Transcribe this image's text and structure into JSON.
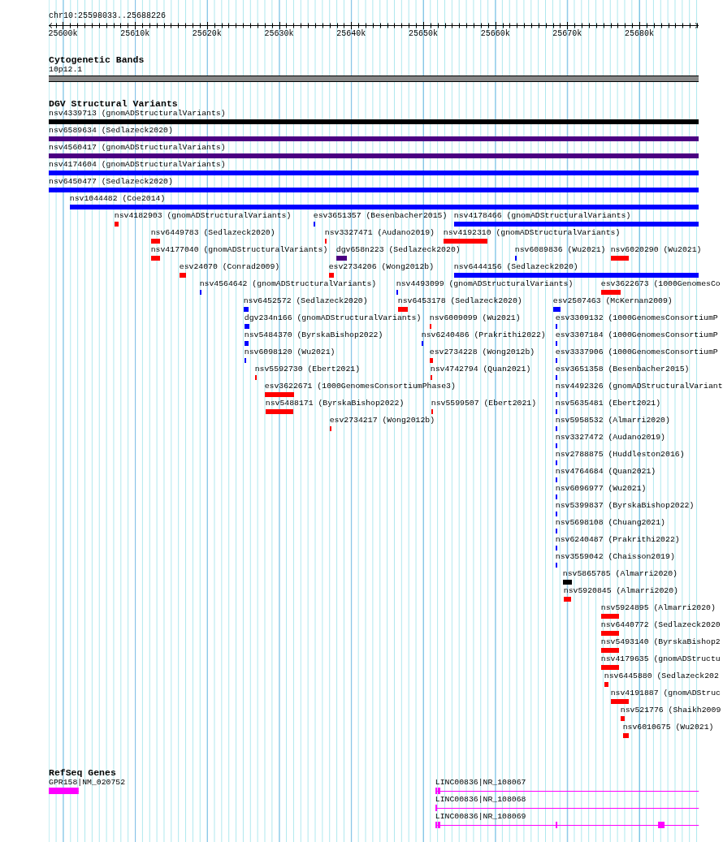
{
  "view": {
    "location": "chr10:25598033..25688226"
  },
  "ticks": [
    "25600k",
    "25610k",
    "25620k",
    "25630k",
    "25640k",
    "25650k",
    "25660k",
    "25670k",
    "25680k"
  ],
  "tracks": [
    {
      "kind": "cytoband",
      "title": "Cytogenetic Bands",
      "bands": [
        {
          "name": "10p12.1",
          "color": "#888888"
        }
      ]
    },
    {
      "kind": "variants",
      "title": "DGV Structural Variants",
      "rows": [
        [
          {
            "label": "nsv4339713 (gnomADStructuralVariants)",
            "color": "#000000"
          }
        ],
        [
          {
            "label": "nsv6589634 (Sedlazeck2020)",
            "color": "#4b0082"
          }
        ],
        [
          {
            "label": "nsv4560417 (gnomADStructuralVariants)",
            "color": "#4b0082"
          }
        ],
        [
          {
            "label": "nsv4174604 (gnomADStructuralVariants)",
            "color": "#0000ff"
          }
        ],
        [
          {
            "label": "nsv6450477 (Sedlazeck2020)",
            "color": "#0000ff"
          }
        ],
        [
          {
            "label": "nsv1044482 (Coe2014)",
            "color": "#0000ff"
          }
        ],
        [
          {
            "label": "nsv4182903 (gnomADStructuralVariants)",
            "color": "#ff0000"
          },
          {
            "label": "esv3651357 (Besenbacher2015)",
            "color": "#0000ff"
          },
          {
            "label": "nsv4178466 (gnomADStructuralVariants)",
            "color": "#0000ff"
          }
        ],
        [
          {
            "label": "nsv6449783 (Sedlazeck2020)",
            "color": "#ff0000"
          },
          {
            "label": "nsv3327471 (Audano2019)",
            "color": "#ff0000"
          },
          {
            "label": "nsv4192310 (gnomADStructuralVariants)",
            "color": "#ff0000"
          }
        ],
        [
          {
            "label": "nsv4177040 (gnomADStructuralVariants)",
            "color": "#ff0000"
          },
          {
            "label": "dgv658n223 (Sedlazeck2020)",
            "color": "#4b0082"
          },
          {
            "label": "nsv6089836 (Wu2021)",
            "color": "#0000ff"
          },
          {
            "label": "nsv6020290 (Wu2021)",
            "color": "#ff0000"
          }
        ],
        [
          {
            "label": "esv24070 (Conrad2009)",
            "color": "#ff0000"
          },
          {
            "label": "esv2734206 (Wong2012b)",
            "color": "#ff0000"
          },
          {
            "label": "nsv6444156 (Sedlazeck2020)",
            "color": "#0000ff"
          }
        ],
        [
          {
            "label": "nsv4564642 (gnomADStructuralVariants)",
            "color": "#0000ff"
          },
          {
            "label": "nsv4493099 (gnomADStructuralVariants)",
            "color": "#0000ff"
          },
          {
            "label": "esv3622673 (1000GenomesCo",
            "color": "#ff0000"
          }
        ],
        [
          {
            "label": "nsv6452572 (Sedlazeck2020)",
            "color": "#0000ff"
          },
          {
            "label": "nsv6453178 (Sedlazeck2020)",
            "color": "#ff0000"
          },
          {
            "label": "esv2507463 (McKernan2009)",
            "color": "#0000ff"
          }
        ],
        [
          {
            "label": "dgv234n166 (gnomADStructuralVariants)",
            "color": "#0000ff"
          },
          {
            "label": "nsv6009099 (Wu2021)",
            "color": "#ff0000"
          },
          {
            "label": "esv3309132 (1000GenomesConsortiumP",
            "color": "#0000ff"
          }
        ],
        [
          {
            "label": "nsv5484370 (ByrskaBishop2022)",
            "color": "#0000ff"
          },
          {
            "label": "nsv6240486 (Prakrithi2022)",
            "color": "#0000ff"
          },
          {
            "label": "esv3307184 (1000GenomesConsortiumP",
            "color": "#0000ff"
          }
        ],
        [
          {
            "label": "nsv6098120 (Wu2021)",
            "color": "#0000ff"
          },
          {
            "label": "esv2734228 (Wong2012b)",
            "color": "#ff0000"
          },
          {
            "label": "esv3337906 (1000GenomesConsortiumP",
            "color": "#0000ff"
          }
        ],
        [
          {
            "label": "nsv5592730 (Ebert2021)",
            "color": "#ff0000"
          },
          {
            "label": "nsv4742794 (Quan2021)",
            "color": "#ff0000"
          },
          {
            "label": "esv3651358 (Besenbacher2015)",
            "color": "#0000ff"
          }
        ],
        [
          {
            "label": "esv3622671 (1000GenomesConsortiumPhase3)",
            "color": "#ff0000"
          },
          {
            "label": "nsv4492326 (gnomADStructuralVariant",
            "color": "#0000ff"
          }
        ],
        [
          {
            "label": "nsv5488171 (ByrskaBishop2022)",
            "color": "#ff0000"
          },
          {
            "label": "nsv5599507 (Ebert2021)",
            "color": "#ff0000"
          },
          {
            "label": "nsv5635481 (Ebert2021)",
            "color": "#0000ff"
          }
        ],
        [
          {
            "label": "esv2734217 (Wong2012b)",
            "color": "#ff0000"
          },
          {
            "label": "nsv5958532 (Almarri2020)",
            "color": "#0000ff"
          }
        ],
        [
          {
            "label": "nsv3327472 (Audano2019)",
            "color": "#0000ff"
          }
        ],
        [
          {
            "label": "nsv2788875 (Huddleston2016)",
            "color": "#0000ff"
          }
        ],
        [
          {
            "label": "nsv4764684 (Quan2021)",
            "color": "#0000ff"
          }
        ],
        [
          {
            "label": "nsv6096977 (Wu2021)",
            "color": "#0000ff"
          }
        ],
        [
          {
            "label": "nsv5399837 (ByrskaBishop2022)",
            "color": "#0000ff"
          }
        ],
        [
          {
            "label": "nsv5698108 (Chuang2021)",
            "color": "#0000ff"
          }
        ],
        [
          {
            "label": "nsv6240487 (Prakrithi2022)",
            "color": "#0000ff"
          }
        ],
        [
          {
            "label": "nsv3559042 (Chaisson2019)",
            "color": "#0000ff"
          }
        ],
        [
          {
            "label": "nsv5865785 (Almarri2020)",
            "color": "#000000"
          }
        ],
        [
          {
            "label": "nsv5920845 (Almarri2020)",
            "color": "#ff0000"
          }
        ],
        [
          {
            "label": "nsv5924895 (Almarri2020)",
            "color": "#ff0000"
          }
        ],
        [
          {
            "label": "nsv6440772 (Sedlazeck2020",
            "color": "#ff0000"
          }
        ],
        [
          {
            "label": "nsv5493140 (ByrskaBishop2",
            "color": "#ff0000"
          }
        ],
        [
          {
            "label": "nsv4179635 (gnomADStructu",
            "color": "#ff0000"
          }
        ],
        [
          {
            "label": "nsv6445880 (Sedlazeck202",
            "color": "#ff0000"
          }
        ],
        [
          {
            "label": "nsv4191887 (gnomADStruc",
            "color": "#ff0000"
          }
        ],
        [
          {
            "label": "nsv521776 (Shaikh2009",
            "color": "#ff0000"
          }
        ],
        [
          {
            "label": "nsv6010675 (Wu2021)",
            "color": "#ff0000"
          }
        ]
      ]
    },
    {
      "kind": "genes",
      "title": "RefSeq Genes",
      "rows": [
        [
          {
            "label": "GPR158|NM_020752"
          },
          {
            "label": "LINC00836|NR_108067"
          }
        ],
        [
          {
            "label": "LINC00836|NR_108068"
          }
        ],
        [
          {
            "label": "LINC00836|NR_108069"
          }
        ]
      ]
    }
  ]
}
